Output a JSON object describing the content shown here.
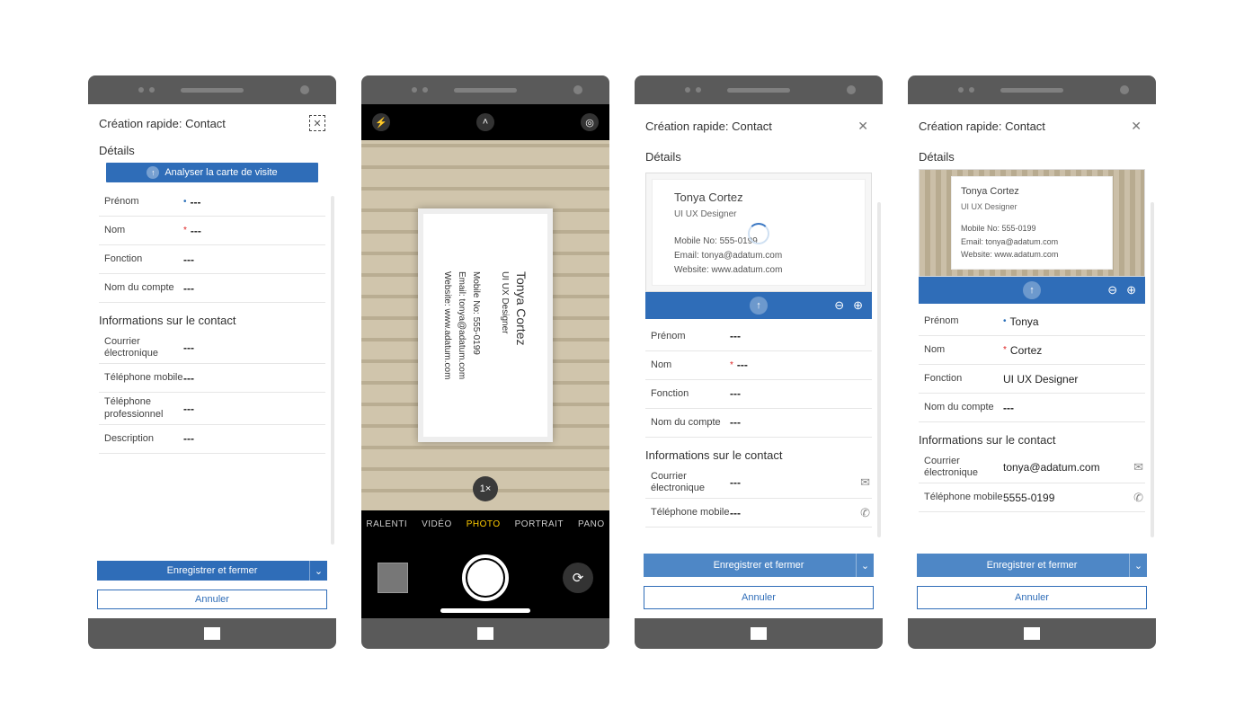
{
  "screen1": {
    "title": "Création rapide: Contact",
    "details_label": "Détails",
    "scan_label": "Analyser la carte de visite",
    "fields": {
      "prenom_label": "Prénom",
      "nom_label": "Nom",
      "fonction_label": "Fonction",
      "compte_label": "Nom du compte"
    },
    "contact_section": "Informations sur le contact",
    "cfields": {
      "email_label": "Courrier électronique",
      "mobile_label": "Téléphone mobile",
      "phone_label": "Téléphone professionnel",
      "desc_label": "Description"
    },
    "empty": "---",
    "save_label": "Enregistrer et fermer",
    "cancel_label": "Annuler"
  },
  "screen2": {
    "zoom": "1×",
    "modes": {
      "ralenti": "RALENTI",
      "video": "VIDÉO",
      "photo": "PHOTO",
      "portrait": "PORTRAIT",
      "pano": "PANO"
    },
    "card": {
      "name": "Tonya Cortez",
      "role": "UI UX Designer",
      "mobile": "Mobile No: 555-0199",
      "email": "Email: tonya@adatum.com",
      "website": "Website: www.adatum.com"
    }
  },
  "screen3": {
    "title": "Création rapide: Contact",
    "details_label": "Détails",
    "card": {
      "name": "Tonya Cortez",
      "role": "UI UX Designer",
      "mobile": "Mobile No: 555-0199",
      "email": "Email: tonya@adatum.com",
      "website": "Website: www.adatum.com"
    },
    "fields": {
      "prenom_label": "Prénom",
      "nom_label": "Nom",
      "fonction_label": "Fonction",
      "compte_label": "Nom du compte"
    },
    "contact_section": "Informations sur le contact",
    "cfields": {
      "email_label": "Courrier électronique",
      "mobile_label": "Téléphone mobile"
    },
    "empty": "---",
    "save_label": "Enregistrer et fermer",
    "cancel_label": "Annuler"
  },
  "screen4": {
    "title": "Création rapide: Contact",
    "details_label": "Détails",
    "card": {
      "name": "Tonya Cortez",
      "role": "UI UX Designer",
      "mobile": "Mobile No: 555-0199",
      "email": "Email: tonya@adatum.com",
      "website": "Website: www.adatum.com"
    },
    "fields": {
      "prenom_label": "Prénom",
      "prenom_val": "Tonya",
      "nom_label": "Nom",
      "nom_val": "Cortez",
      "fonction_label": "Fonction",
      "fonction_val": "UI UX Designer",
      "compte_label": "Nom du compte"
    },
    "contact_section": "Informations sur le contact",
    "cfields": {
      "email_label": "Courrier électronique",
      "email_val": "tonya@adatum.com",
      "mobile_label": "Téléphone mobile",
      "mobile_val": "5555-0199"
    },
    "empty": "---",
    "save_label": "Enregistrer et fermer",
    "cancel_label": "Annuler"
  }
}
